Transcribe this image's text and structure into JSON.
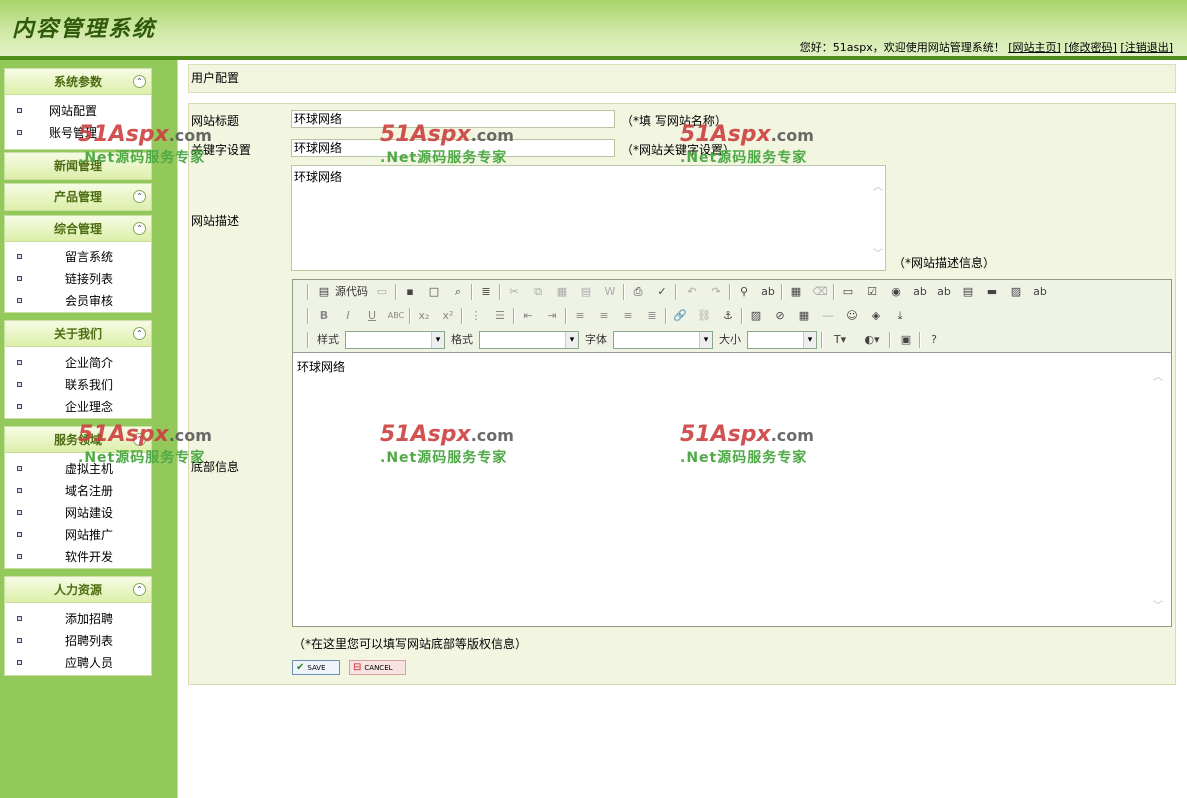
{
  "header": {
    "title": "内容管理系统",
    "welcome": "您好：51aspx，欢迎使用网站管理系统！",
    "links": [
      "[网站主页]",
      "[修改密码]",
      "[注销退出]"
    ]
  },
  "sidebar": {
    "sections": [
      {
        "title": "系统参数",
        "items": [
          "网站配置",
          "账号管理"
        ]
      },
      {
        "title": "新闻管理",
        "items": []
      },
      {
        "title": "产品管理",
        "items": []
      },
      {
        "title": "综合管理",
        "items": [
          "留言系统",
          "链接列表",
          "会员审核"
        ]
      },
      {
        "title": "关于我们",
        "items": [
          "企业简介",
          "联系我们",
          "企业理念"
        ]
      },
      {
        "title": "服务领域",
        "items": [
          "虚拟主机",
          "域名注册",
          "网站建设",
          "网站推广",
          "软件开发"
        ]
      },
      {
        "title": "人力资源",
        "items": [
          "添加招聘",
          "招聘列表",
          "应聘人员"
        ]
      }
    ]
  },
  "main": {
    "breadcrumb": "用户配置",
    "site_title": {
      "label": "网站标题",
      "value": "环球网络",
      "hint": "（*填 写网站名称）"
    },
    "keywords": {
      "label": "关键字设置",
      "value": "环球网络",
      "hint": "（*网站关键字设置）"
    },
    "description": {
      "label": "网站描述",
      "value": "环球网络",
      "hint": "（*网站描述信息）"
    },
    "footer": {
      "label": "底部信息",
      "content": "环球网络",
      "hint": "（*在这里您可以填写网站底部等版权信息）"
    },
    "editor": {
      "source_label": "源代码",
      "style_label": "样式",
      "format_label": "格式",
      "font_label": "字体",
      "size_label": "大小"
    },
    "save_label": "SAVE",
    "cancel_label": "CANCEL"
  },
  "watermark": {
    "brand": "51Aspx",
    "suffix": ".com",
    "slogan": ".Net源码服务专家"
  }
}
